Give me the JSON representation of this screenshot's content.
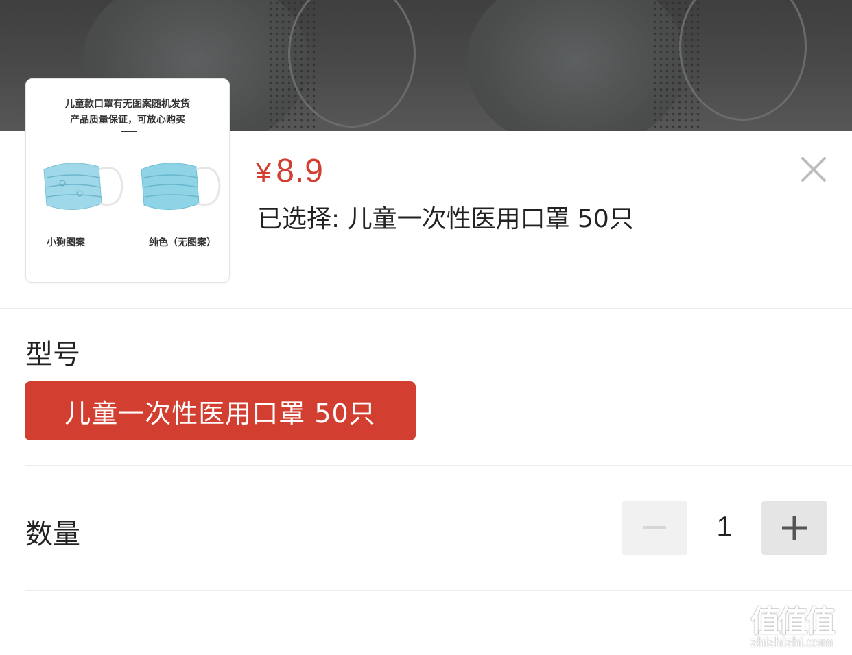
{
  "product_image": {
    "line1": "儿童款口罩有无图案随机发货",
    "line2": "产品质量保证，可放心购买",
    "caption_left": "小狗图案",
    "caption_right": "纯色（无图案）"
  },
  "price": {
    "currency": "¥",
    "amount": "8.9"
  },
  "selected_text": "已选择: 儿童一次性医用口罩 50只",
  "model_section": {
    "title": "型号",
    "option": "儿童一次性医用口罩 50只"
  },
  "quantity_section": {
    "title": "数量",
    "value": "1"
  },
  "watermark": {
    "glyphs": "值值值",
    "url": "zhizhizhi.com"
  },
  "colors": {
    "accent": "#d23f31",
    "mask_blue": "#8fd3e6"
  },
  "icons": {
    "close": "close-icon",
    "minus": "minus-icon",
    "plus": "plus-icon"
  }
}
